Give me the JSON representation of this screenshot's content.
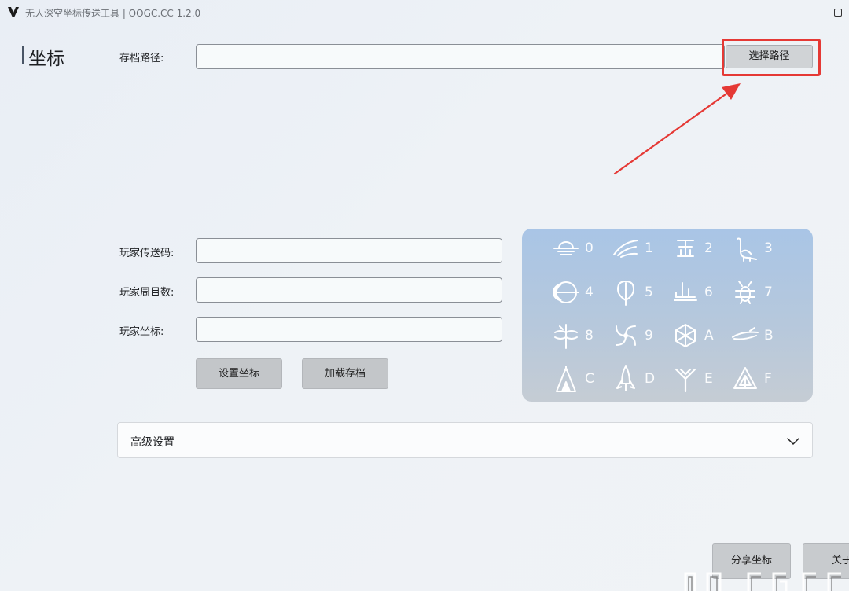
{
  "window": {
    "title": "无人深空坐标传送工具 | OOGC.CC 1.2.0",
    "logo_icon": "v-logo-icon",
    "minimize_icon": "minimize-icon",
    "maximize_icon": "maximize-icon"
  },
  "page": {
    "title": "坐标"
  },
  "save_path": {
    "label": "存档路径:",
    "value": "",
    "browse_label": "选择路径"
  },
  "player": {
    "code_label": "玩家传送码:",
    "code_value": "",
    "cycle_label": "玩家周目数:",
    "cycle_value": "",
    "coord_label": "玩家坐标:",
    "coord_value": ""
  },
  "actions": {
    "set_coords_label": "设置坐标",
    "load_save_label": "加载存档"
  },
  "glyphs": [
    {
      "char": "0",
      "icon": "sunset-glyph-icon"
    },
    {
      "char": "1",
      "icon": "bird-glyph-icon"
    },
    {
      "char": "2",
      "icon": "face-glyph-icon"
    },
    {
      "char": "3",
      "icon": "diplo-glyph-icon"
    },
    {
      "char": "4",
      "icon": "eclipse-glyph-icon"
    },
    {
      "char": "5",
      "icon": "balloon-glyph-icon"
    },
    {
      "char": "6",
      "icon": "boat-glyph-icon"
    },
    {
      "char": "7",
      "icon": "bug-glyph-icon"
    },
    {
      "char": "8",
      "icon": "dragonfly-glyph-icon"
    },
    {
      "char": "9",
      "icon": "galaxy-glyph-icon"
    },
    {
      "char": "A",
      "icon": "voxel-glyph-icon"
    },
    {
      "char": "B",
      "icon": "fish-glyph-icon"
    },
    {
      "char": "C",
      "icon": "tent-glyph-icon"
    },
    {
      "char": "D",
      "icon": "rocket-glyph-icon"
    },
    {
      "char": "E",
      "icon": "tree-glyph-icon"
    },
    {
      "char": "F",
      "icon": "atlas-glyph-icon"
    }
  ],
  "advanced": {
    "label": "高级设置",
    "expand_icon": "chevron-down-icon"
  },
  "bottom_actions": {
    "share_label": "分享坐标",
    "about_label": "关于"
  },
  "watermark": {
    "text": "OOGC.CC"
  },
  "colors": {
    "highlight": "#e53935",
    "panel_top": "#a9c5e6",
    "button_gray": "#c3c6c9"
  }
}
